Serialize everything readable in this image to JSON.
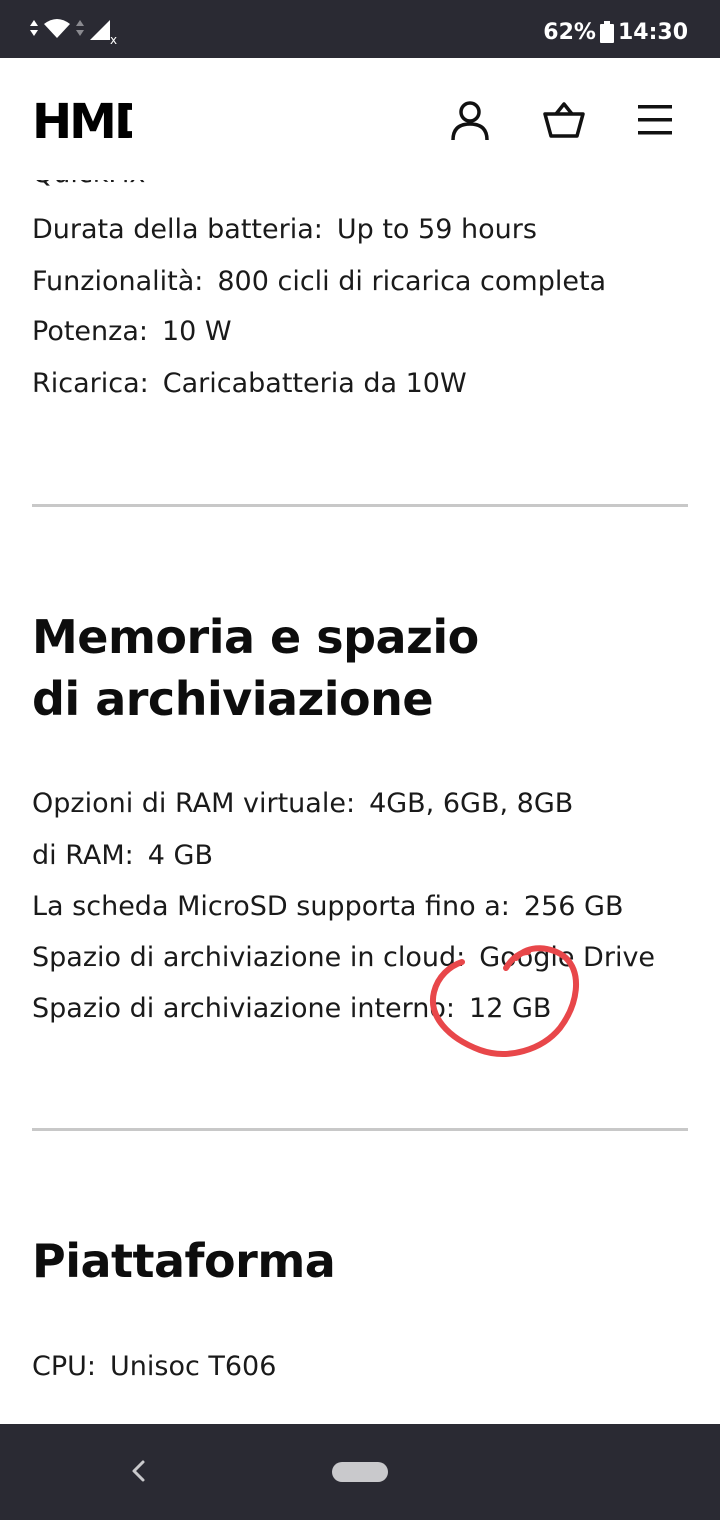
{
  "status_bar": {
    "battery": "62%",
    "time": "14:30",
    "icons": [
      "data-arrows-icon",
      "wifi-icon",
      "signal-icon",
      "no-signal-icon",
      "battery-icon"
    ]
  },
  "header": {
    "logo": "HMD",
    "icons": [
      "user-icon",
      "basket-icon",
      "menu-icon"
    ]
  },
  "battery_section": {
    "cut_text": "QuickFix",
    "rows": [
      {
        "key": "Durata della batteria:",
        "value": "Up to 59 hours"
      },
      {
        "key": "Funzionalità:",
        "value": "800 cicli di ricarica completa"
      },
      {
        "key": "Potenza:",
        "value": "10 W"
      },
      {
        "key": "Ricarica:",
        "value": "Caricabatteria da 10W"
      }
    ]
  },
  "memory_section": {
    "title_line1": "Memoria e spazio",
    "title_line2": "di archiviazione",
    "rows": [
      {
        "key": "Opzioni di RAM virtuale:",
        "value": "4GB, 6GB, 8GB"
      },
      {
        "key": "di RAM:",
        "value": "4 GB"
      },
      {
        "key": "La scheda MicroSD supporta fino a:",
        "value": "256 GB"
      },
      {
        "key": "Spazio di archiviazione in cloud:",
        "value": "Google Drive"
      },
      {
        "key": "Spazio di archiviazione interno:",
        "value": "12 GB"
      }
    ],
    "annotation_color": "#e8474a"
  },
  "platform_section": {
    "title": "Piattaforma",
    "rows": [
      {
        "key": "CPU:",
        "value": "Unisoc T606"
      }
    ]
  },
  "nav_bar": {
    "icons": [
      "back-icon",
      "home-pill"
    ]
  },
  "colors": {
    "system_bar": "#2a2a33",
    "divider": "#c8c8c8",
    "text": "#1a1a1a"
  }
}
